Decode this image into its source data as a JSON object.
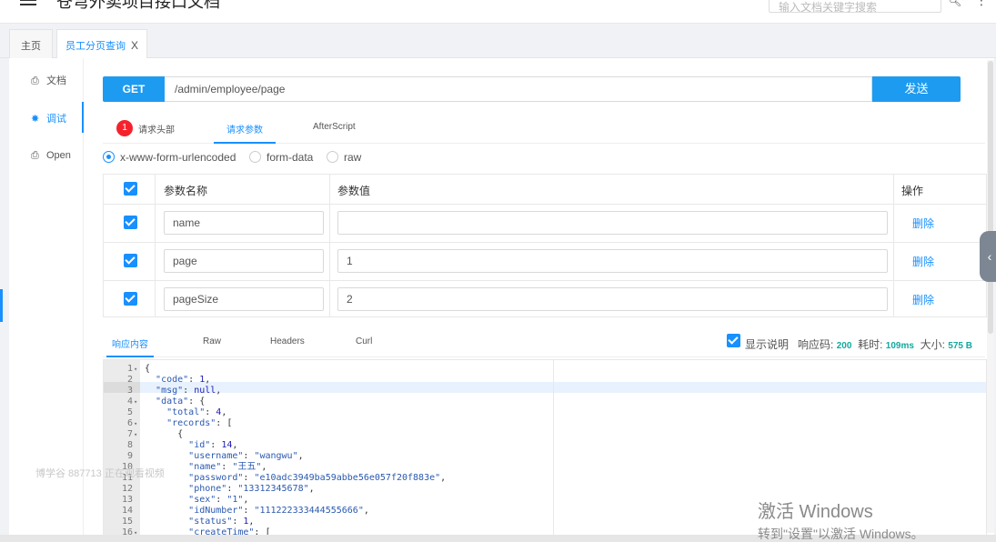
{
  "header": {
    "app_title": "苍穹外卖项目接口文档",
    "search_placeholder": "输入文档关键字搜索"
  },
  "tabs": {
    "home": "主页",
    "active": "员工分页查询",
    "close": "X"
  },
  "nav": {
    "items": [
      {
        "label": "文档",
        "icon": "doc-icon"
      },
      {
        "label": "调试",
        "icon": "bug-icon"
      },
      {
        "label": "Open",
        "icon": "file-icon"
      }
    ]
  },
  "request": {
    "method": "GET",
    "url": "/admin/employee/page",
    "send_label": "发送",
    "tabs": {
      "headers_badge": "1",
      "headers": "请求头部",
      "params": "请求参数",
      "after": "AfterScript"
    },
    "body_types": [
      "x-www-form-urlencoded",
      "form-data",
      "raw"
    ],
    "table": {
      "col_name": "参数名称",
      "col_value": "参数值",
      "col_action": "操作",
      "delete_label": "删除",
      "rows": [
        {
          "name": "name",
          "value": ""
        },
        {
          "name": "page",
          "value": "1"
        },
        {
          "name": "pageSize",
          "value": "2"
        }
      ]
    }
  },
  "response": {
    "tabs": [
      "响应内容",
      "Raw",
      "Headers",
      "Curl"
    ],
    "show_desc": "显示说明",
    "code_label": "响应码:",
    "code_value": "200",
    "time_label": "耗时:",
    "time_value": "109ms",
    "size_label": "大小:",
    "size_value": "575 B",
    "lines": [
      {
        "n": "1",
        "fold": true,
        "text": "{"
      },
      {
        "n": "2",
        "fold": false,
        "text": "  \"code\": 1,"
      },
      {
        "n": "3",
        "fold": false,
        "text": "  \"msg\": null,"
      },
      {
        "n": "4",
        "fold": true,
        "text": "  \"data\": {"
      },
      {
        "n": "5",
        "fold": false,
        "text": "    \"total\": 4,"
      },
      {
        "n": "6",
        "fold": true,
        "text": "    \"records\": ["
      },
      {
        "n": "7",
        "fold": true,
        "text": "      {"
      },
      {
        "n": "8",
        "fold": false,
        "text": "        \"id\": 14,"
      },
      {
        "n": "9",
        "fold": false,
        "text": "        \"username\": \"wangwu\","
      },
      {
        "n": "10",
        "fold": false,
        "text": "        \"name\": \"王五\","
      },
      {
        "n": "11",
        "fold": false,
        "text": "        \"password\": \"e10adc3949ba59abbe56e057f20f883e\","
      },
      {
        "n": "12",
        "fold": false,
        "text": "        \"phone\": \"13312345678\","
      },
      {
        "n": "13",
        "fold": false,
        "text": "        \"sex\": \"1\","
      },
      {
        "n": "14",
        "fold": false,
        "text": "        \"idNumber\": \"111222333444555666\","
      },
      {
        "n": "15",
        "fold": false,
        "text": "        \"status\": 1,"
      },
      {
        "n": "16",
        "fold": true,
        "text": "        \"createTime\": ["
      }
    ]
  },
  "overlays": {
    "watermark": "博学谷 887713 正在观看视频",
    "activate_title": "激活 Windows",
    "activate_sub": "转到\"设置\"以激活 Windows。"
  },
  "colors": {
    "accent": "#1890ff",
    "method_bg": "#1d9bf0",
    "badge": "#f5222d",
    "meta_value": "#13a89e"
  }
}
